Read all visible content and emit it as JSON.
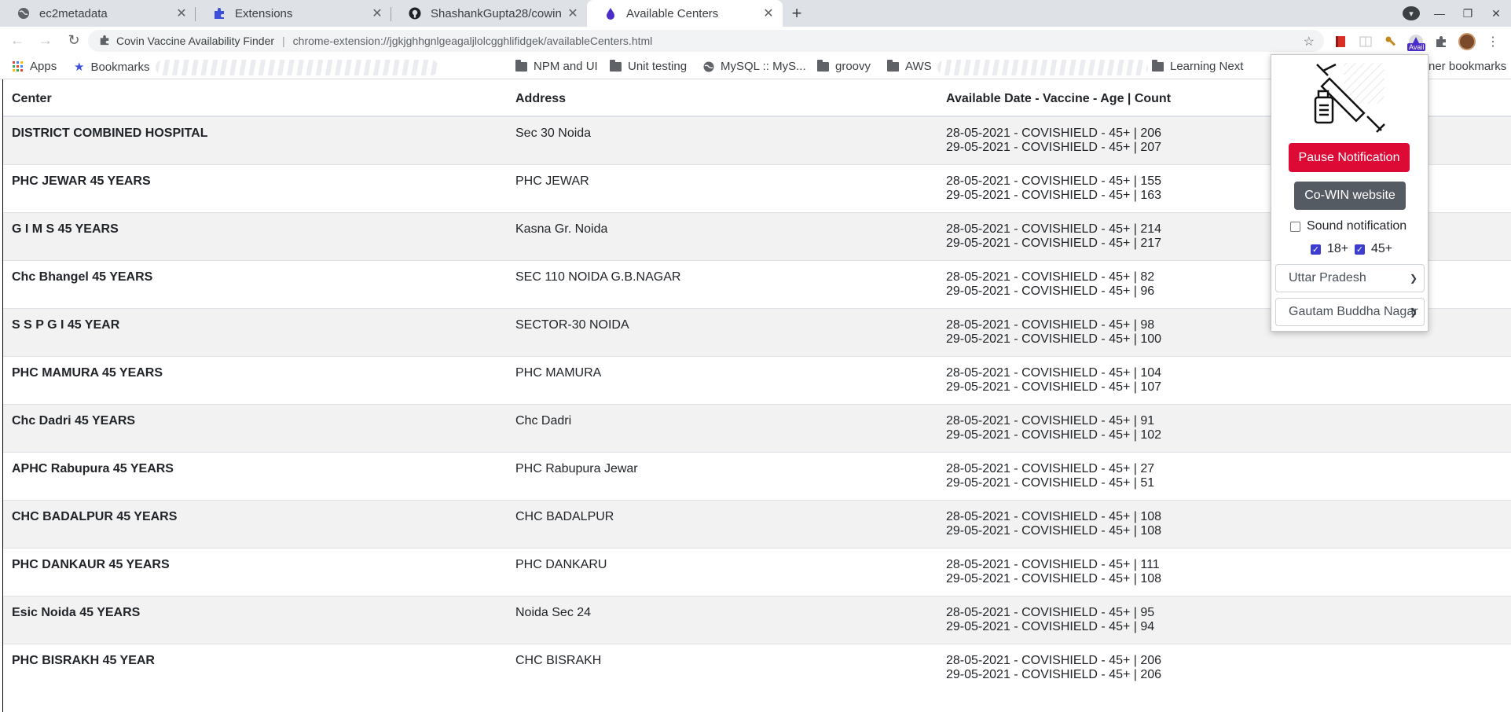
{
  "tabs": [
    {
      "title": "ec2metadata",
      "icon": "globe-icon"
    },
    {
      "title": "Extensions",
      "icon": "puzzle-icon"
    },
    {
      "title": "ShashankGupta28/cowin",
      "icon": "github-icon"
    },
    {
      "title": "Available Centers",
      "icon": "drop-icon"
    }
  ],
  "toolbar": {
    "site_name": "Covin Vaccine Availability Finder",
    "url": "chrome-extension://jgkjghhgnlgeagaljlolcgghlifidgek/availableCenters.html",
    "ext_badge": "Avail"
  },
  "bookmarks": {
    "apps": "Apps",
    "bookmarks": "Bookmarks",
    "npm": "NPM and UI",
    "unit": "Unit testing",
    "mysql": "MySQL :: MyS...",
    "groovy": "groovy",
    "aws": "AWS",
    "learning": "Learning Next",
    "other": "ner bookmarks"
  },
  "table": {
    "headers": [
      "Center",
      "Address",
      "Available Date - Vaccine - Age | Count"
    ],
    "rows": [
      {
        "center": "DISTRICT COMBINED HOSPITAL",
        "address": "Sec 30 Noida",
        "line1": "28-05-2021 - COVISHIELD - 45+ | 206",
        "line2": "29-05-2021 - COVISHIELD - 45+ | 207"
      },
      {
        "center": "PHC JEWAR 45 YEARS",
        "address": "PHC JEWAR",
        "line1": "28-05-2021 - COVISHIELD - 45+ | 155",
        "line2": "29-05-2021 - COVISHIELD - 45+ | 163"
      },
      {
        "center": "G I M S 45 YEARS",
        "address": "Kasna Gr. Noida",
        "line1": "28-05-2021 - COVISHIELD - 45+ | 214",
        "line2": "29-05-2021 - COVISHIELD - 45+ | 217"
      },
      {
        "center": "Chc Bhangel 45 YEARS",
        "address": "SEC 110 NOIDA G.B.NAGAR",
        "line1": "28-05-2021 - COVISHIELD - 45+ | 82",
        "line2": "29-05-2021 - COVISHIELD - 45+ | 96"
      },
      {
        "center": "S S P G I 45 YEAR",
        "address": "SECTOR-30 NOIDA",
        "line1": "28-05-2021 - COVISHIELD - 45+ | 98",
        "line2": "29-05-2021 - COVISHIELD - 45+ | 100"
      },
      {
        "center": "PHC MAMURA 45 YEARS",
        "address": "PHC MAMURA",
        "line1": "28-05-2021 - COVISHIELD - 45+ | 104",
        "line2": "29-05-2021 - COVISHIELD - 45+ | 107"
      },
      {
        "center": "Chc Dadri 45 YEARS",
        "address": "Chc Dadri",
        "line1": "28-05-2021 - COVISHIELD - 45+ | 91",
        "line2": "29-05-2021 - COVISHIELD - 45+ | 102"
      },
      {
        "center": "APHC Rabupura 45 YEARS",
        "address": "PHC Rabupura Jewar",
        "line1": "28-05-2021 - COVISHIELD - 45+ | 27",
        "line2": "29-05-2021 - COVISHIELD - 45+ | 51"
      },
      {
        "center": "CHC BADALPUR 45 YEARS",
        "address": "CHC BADALPUR",
        "line1": "28-05-2021 - COVISHIELD - 45+ | 108",
        "line2": "29-05-2021 - COVISHIELD - 45+ | 108"
      },
      {
        "center": "PHC DANKAUR 45 YEARS",
        "address": "PHC DANKARU",
        "line1": "28-05-2021 - COVISHIELD - 45+ | 111",
        "line2": "29-05-2021 - COVISHIELD - 45+ | 108"
      },
      {
        "center": "Esic Noida 45 YEARS",
        "address": "Noida Sec 24",
        "line1": "28-05-2021 - COVISHIELD - 45+ | 95",
        "line2": "29-05-2021 - COVISHIELD - 45+ | 94"
      },
      {
        "center": "PHC BISRAKH 45 YEAR",
        "address": "CHC BISRAKH",
        "line1": "28-05-2021 - COVISHIELD - 45+ | 206",
        "line2": "29-05-2021 - COVISHIELD - 45+ | 206"
      }
    ]
  },
  "popup": {
    "pause_label": "Pause Notification",
    "cowin_label": "Co-WIN website",
    "sound_label": "Sound notification",
    "sound_checked": false,
    "age18_label": "18+",
    "age18_checked": true,
    "age45_label": "45+",
    "age45_checked": true,
    "state": "Uttar Pradesh",
    "district": "Gautam Buddha Nagar",
    "pause_color": "#dc0a35",
    "cowin_color": "#545b62"
  }
}
